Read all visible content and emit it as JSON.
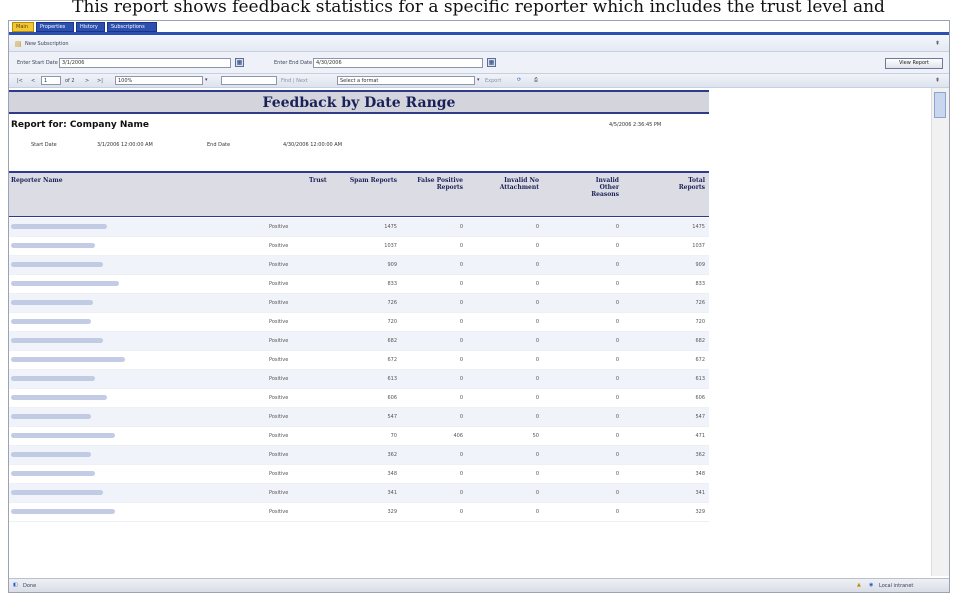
{
  "caption": "This report shows feedback statistics for a specific reporter which includes the trust level and",
  "tabs": [
    "Main",
    "Properties",
    "History",
    "Subscriptions"
  ],
  "toolbar": {
    "new_subscription": "New Subscription",
    "collapse_glyph": "⇞"
  },
  "dates": {
    "start_label": "Enter Start Date",
    "start_value": "3/1/2006",
    "end_label": "Enter End Date",
    "end_value": "4/30/2006",
    "view_report": "View Report"
  },
  "nav": {
    "first": "|<",
    "prev": "<",
    "page_value": "1",
    "of_label": "of 2",
    "next": ">",
    "last": ">|",
    "zoom": "100%",
    "find": "Find | Next",
    "format": "Select a format",
    "export": "Export"
  },
  "report": {
    "title": "Feedback by Date Range",
    "report_for_label": "Report for:",
    "company": "Company Name",
    "generated": "4/5/2006 2:36:45 PM",
    "start_date_label": "Start Date",
    "start_date_value": "3/1/2006 12:00:00 AM",
    "end_date_label": "End Date",
    "end_date_value": "4/30/2006 12:00:00 AM"
  },
  "table": {
    "headers": {
      "reporter": "Reporter Name",
      "trust": "Trust",
      "spam": "Spam Reports",
      "false_pos": "False Positive Reports",
      "invalid_no_att": "Invalid No Attachment",
      "invalid_other": "Invalid Other Reasons",
      "total": "Total Reports"
    },
    "rows": [
      {
        "trust": "Positive",
        "spam": "1475",
        "fp": "0",
        "ina": "0",
        "io": "0",
        "total": "1475"
      },
      {
        "trust": "Positive",
        "spam": "1037",
        "fp": "0",
        "ina": "0",
        "io": "0",
        "total": "1037"
      },
      {
        "trust": "Positive",
        "spam": "909",
        "fp": "0",
        "ina": "0",
        "io": "0",
        "total": "909"
      },
      {
        "trust": "Positive",
        "spam": "833",
        "fp": "0",
        "ina": "0",
        "io": "0",
        "total": "833"
      },
      {
        "trust": "Positive",
        "spam": "726",
        "fp": "0",
        "ina": "0",
        "io": "0",
        "total": "726"
      },
      {
        "trust": "Positive",
        "spam": "720",
        "fp": "0",
        "ina": "0",
        "io": "0",
        "total": "720"
      },
      {
        "trust": "Positive",
        "spam": "682",
        "fp": "0",
        "ina": "0",
        "io": "0",
        "total": "682"
      },
      {
        "trust": "Positive",
        "spam": "672",
        "fp": "0",
        "ina": "0",
        "io": "0",
        "total": "672"
      },
      {
        "trust": "Positive",
        "spam": "613",
        "fp": "0",
        "ina": "0",
        "io": "0",
        "total": "613"
      },
      {
        "trust": "Positive",
        "spam": "606",
        "fp": "0",
        "ina": "0",
        "io": "0",
        "total": "606"
      },
      {
        "trust": "Positive",
        "spam": "547",
        "fp": "0",
        "ina": "0",
        "io": "0",
        "total": "547"
      },
      {
        "trust": "Positive",
        "spam": "70",
        "fp": "406",
        "ina": "50",
        "io": "0",
        "total": "471"
      },
      {
        "trust": "Positive",
        "spam": "362",
        "fp": "0",
        "ina": "0",
        "io": "0",
        "total": "362"
      },
      {
        "trust": "Positive",
        "spam": "348",
        "fp": "0",
        "ina": "0",
        "io": "0",
        "total": "348"
      },
      {
        "trust": "Positive",
        "spam": "341",
        "fp": "0",
        "ina": "0",
        "io": "0",
        "total": "341"
      },
      {
        "trust": "Positive",
        "spam": "329",
        "fp": "0",
        "ina": "0",
        "io": "0",
        "total": "329"
      }
    ]
  },
  "status": {
    "left": "Done",
    "right": "Local intranet"
  }
}
